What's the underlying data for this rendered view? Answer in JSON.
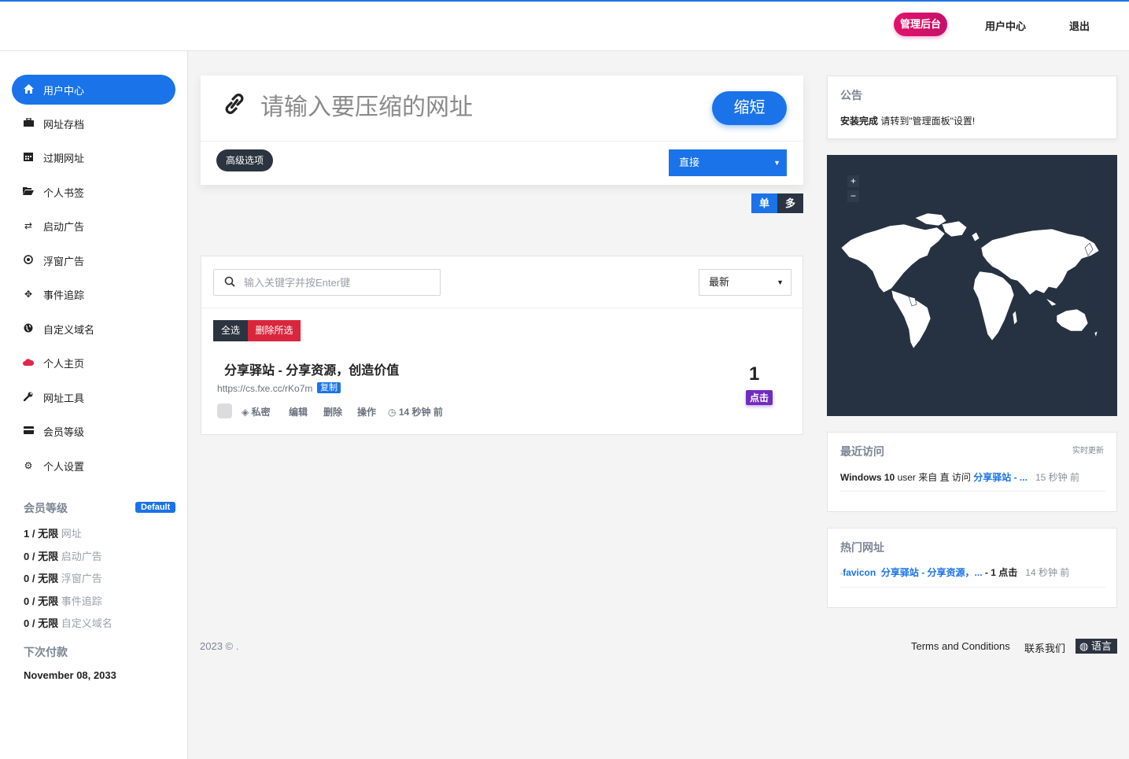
{
  "header": {
    "admin_label": "管理后台",
    "user_center_label": "用户中心",
    "logout_label": "退出"
  },
  "sidebar": {
    "items": [
      {
        "label": "用户中心",
        "icon": "home-icon"
      },
      {
        "label": "网址存档",
        "icon": "briefcase-icon"
      },
      {
        "label": "过期网址",
        "icon": "calendar-icon"
      },
      {
        "label": "个人书签",
        "icon": "folder-open-icon"
      },
      {
        "label": "启动广告",
        "icon": "exchange-icon"
      },
      {
        "label": "浮窗广告",
        "icon": "dot-circle-icon"
      },
      {
        "label": "事件追踪",
        "icon": "crosshairs-icon"
      },
      {
        "label": "自定义域名",
        "icon": "globe-icon"
      },
      {
        "label": "个人主页",
        "icon": "cloud-icon"
      },
      {
        "label": "网址工具",
        "icon": "wrench-icon"
      },
      {
        "label": "会员等级",
        "icon": "credit-card-icon"
      },
      {
        "label": "个人设置",
        "icon": "gear-icon"
      }
    ],
    "plan": {
      "title": "会员等级",
      "badge": "Default",
      "stats": [
        {
          "count": "1 / 无限",
          "label": "网址"
        },
        {
          "count": "0 / 无限",
          "label": "启动广告"
        },
        {
          "count": "0 / 无限",
          "label": "浮窗广告"
        },
        {
          "count": "0 / 无限",
          "label": "事件追踪"
        },
        {
          "count": "0 / 无限",
          "label": "自定义域名"
        }
      ]
    },
    "next_payment": {
      "title": "下次付款",
      "date": "November 08, 2033"
    }
  },
  "shorten": {
    "placeholder": "请输入要压缩的网址",
    "button": "缩短",
    "advanced": "高级选项",
    "type_select": "直接",
    "toggle_single": "单",
    "toggle_multi": "多"
  },
  "links": {
    "search_placeholder": "输入关键字并按Enter键",
    "sort": "最新",
    "select_all": "全选",
    "delete_selected": "删除所选",
    "items": [
      {
        "title": "分享驿站 - 分享资源，创造价值",
        "short_url": "https://cs.fxe.cc/rKo7m",
        "copy": "复制",
        "private": "私密",
        "edit": "编辑",
        "delete": "删除",
        "actions": "操作",
        "time": "14 秒钟 前",
        "clicks": "1",
        "clicks_label": "点击"
      }
    ]
  },
  "notice": {
    "title": "公告",
    "bold": "安装完成",
    "text": " 请转到\"管理面板\"设置!"
  },
  "map": {
    "zoom_in": "+",
    "zoom_out": "−"
  },
  "recent": {
    "title": "最近访问",
    "realtime": "实时更新",
    "os": "Windows 10",
    "user": " user 来自 直 访问 ",
    "link": "分享驿站 - ...",
    "time": "15 秒钟 前"
  },
  "hot": {
    "title": "热门网址",
    "favicon_alt": "favicon",
    "link": "分享驿站 - 分享资源，...",
    "clicks": " - 1 点击",
    "time": "14 秒钟 前"
  },
  "footer": {
    "copyright": "2023 © .",
    "terms": "Terms and Conditions",
    "contact": "联系我们",
    "language": "语言"
  },
  "colors": {
    "primary": "#1a73e8",
    "admin_pink": "#e0126b",
    "dark": "#2b3440",
    "danger": "#d9263c",
    "purple": "#6f2dbd",
    "map_bg": "#263241"
  }
}
